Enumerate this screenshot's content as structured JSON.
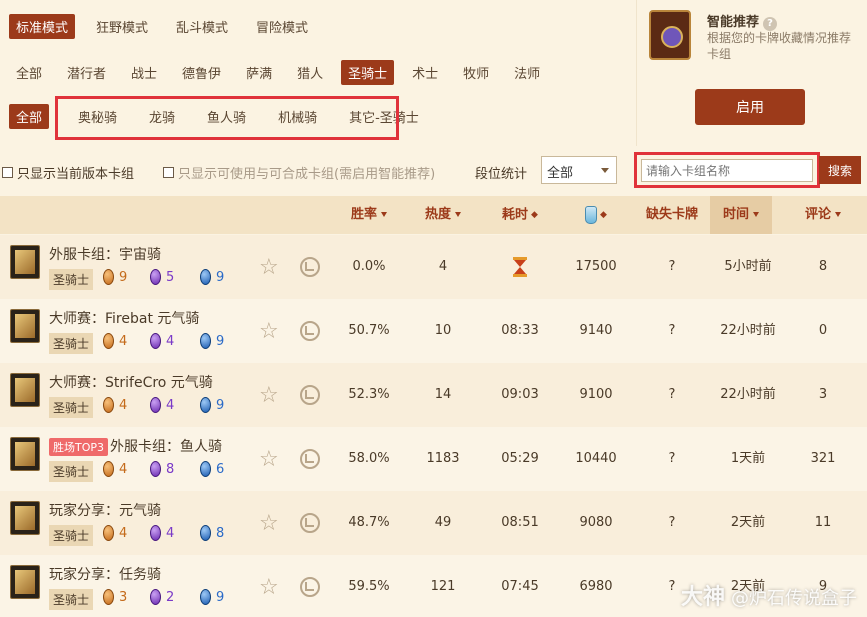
{
  "modes": [
    "标准模式",
    "狂野模式",
    "乱斗模式",
    "冒险模式"
  ],
  "classes": [
    "全部",
    "潜行者",
    "战士",
    "德鲁伊",
    "萨满",
    "猎人",
    "圣骑士",
    "术士",
    "牧师",
    "法师"
  ],
  "subcategory": {
    "all_label": "全部",
    "items": [
      "奥秘骑",
      "龙骑",
      "鱼人骑",
      "机械骑",
      "其它-圣骑士"
    ]
  },
  "smart": {
    "title": "智能推荐",
    "help": "?",
    "desc": "根据您的卡牌收藏情况推荐卡组",
    "button": "启用"
  },
  "filters": {
    "current_version": "只显示当前版本卡组",
    "craftable": "只显示可使用与可合成卡组(需启用智能推荐)",
    "rank_label": "段位统计",
    "rank_value": "全部",
    "search_placeholder": "请输入卡组名称",
    "search_button": "搜索"
  },
  "columns": {
    "winrate": "胜率",
    "popularity": "热度",
    "duration": "耗时",
    "missing": "缺失卡牌",
    "time": "时间",
    "comments": "评论"
  },
  "colors": {
    "accent": "#9c3a1a",
    "highlight_box": "#e0323a",
    "badge": "#ef6a6a"
  },
  "decks": [
    {
      "badge": "",
      "name": "外服卡组：宇宙骑",
      "class": "圣骑士",
      "orange": "9",
      "purple": "5",
      "blue": "9",
      "winrate": "0.0%",
      "popularity": "4",
      "duration": "",
      "dust": "17500",
      "missing": "?",
      "time": "5小时前",
      "comments": "8"
    },
    {
      "badge": "",
      "name": "大师赛：Firebat 元气骑",
      "class": "圣骑士",
      "orange": "4",
      "purple": "4",
      "blue": "9",
      "winrate": "50.7%",
      "popularity": "10",
      "duration": "08:33",
      "dust": "9140",
      "missing": "?",
      "time": "22小时前",
      "comments": "0"
    },
    {
      "badge": "",
      "name": "大师赛：StrifeCro 元气骑",
      "class": "圣骑士",
      "orange": "4",
      "purple": "4",
      "blue": "9",
      "winrate": "52.3%",
      "popularity": "14",
      "duration": "09:03",
      "dust": "9100",
      "missing": "?",
      "time": "22小时前",
      "comments": "3"
    },
    {
      "badge": "胜场TOP3",
      "name": "外服卡组：鱼人骑",
      "class": "圣骑士",
      "orange": "4",
      "purple": "8",
      "blue": "6",
      "winrate": "58.0%",
      "popularity": "1183",
      "duration": "05:29",
      "dust": "10440",
      "missing": "?",
      "time": "1天前",
      "comments": "321"
    },
    {
      "badge": "",
      "name": "玩家分享：元气骑",
      "class": "圣骑士",
      "orange": "4",
      "purple": "4",
      "blue": "8",
      "winrate": "48.7%",
      "popularity": "49",
      "duration": "08:51",
      "dust": "9080",
      "missing": "?",
      "time": "2天前",
      "comments": "11"
    },
    {
      "badge": "",
      "name": "玩家分享：任务骑",
      "class": "圣骑士",
      "orange": "3",
      "purple": "2",
      "blue": "9",
      "winrate": "59.5%",
      "popularity": "121",
      "duration": "07:45",
      "dust": "6980",
      "missing": "?",
      "time": "2天前",
      "comments": "9"
    }
  ],
  "watermark": {
    "brand": "大神",
    "text": "@炉石传说盒子"
  }
}
